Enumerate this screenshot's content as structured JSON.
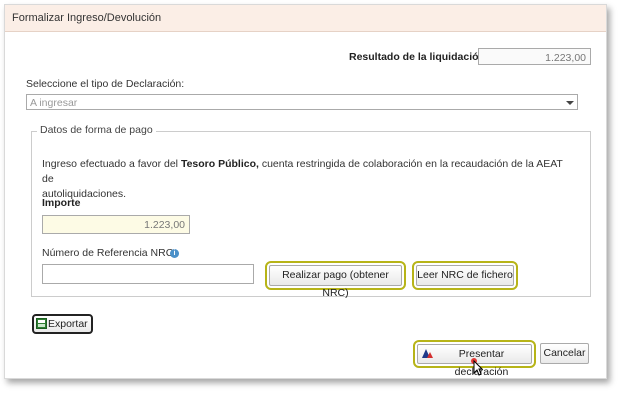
{
  "window": {
    "title": "Formalizar Ingreso/Devolución"
  },
  "resultado": {
    "label": "Resultado de la liquidación",
    "value": "1.223,00"
  },
  "tipo_declaracion": {
    "label": "Seleccione el tipo de Declaración:",
    "selected": "A ingresar"
  },
  "forma_pago": {
    "legend": "Datos de forma de pago",
    "texto_pre": "Ingreso efectuado a favor del",
    "texto_bold": "Tesoro Público,",
    "texto_post": "cuenta restringida de colaboración en la recaudación de la AEAT de",
    "texto_line2": "autoliquidaciones.",
    "importe_label": "Importe",
    "importe_value": "1.223,00",
    "nrc_label": "Número de Referencia  NRC:",
    "nrc_value": "",
    "realizar_pago": "Realizar pago (obtener NRC)",
    "leer_nrc": "Leer NRC de fichero"
  },
  "actions": {
    "exportar": "Exportar",
    "presentar": "Presentar declaración",
    "cancelar": "Cancelar"
  },
  "colors": {
    "highlight": "#b7b418",
    "titlebar": "#fbeee6",
    "importe_bg": "#fdfbe5"
  }
}
